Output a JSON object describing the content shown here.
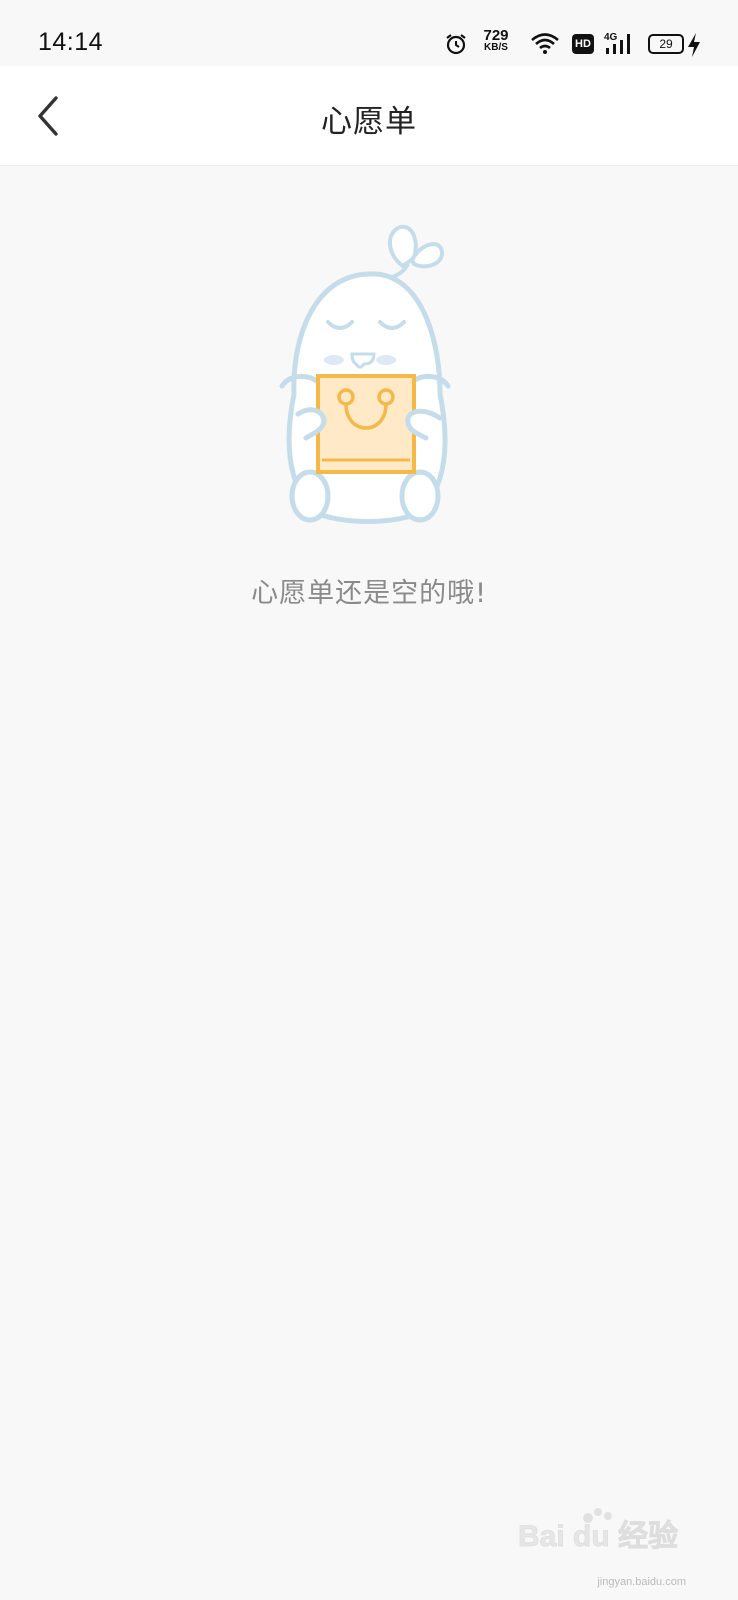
{
  "status_bar": {
    "time": "14:14",
    "net_speed_value": "729",
    "net_speed_unit": "KB/S",
    "hd_label": "HD",
    "network_type": "4G",
    "battery_level": "29",
    "icons": [
      "alarm-icon",
      "wifi-icon",
      "signal-icon",
      "battery-icon",
      "charging-icon"
    ]
  },
  "nav": {
    "title": "心愿单",
    "back_icon": "chevron-left-icon"
  },
  "empty_state": {
    "message": "心愿单还是空的哦!",
    "illustration": "mascot-holding-shopping-bag"
  },
  "watermark": {
    "brand": "Bai du 经验",
    "url": "jingyan.baidu.com"
  },
  "colors": {
    "background": "#f8f8f8",
    "nav_background": "#ffffff",
    "mascot_outline": "#c5dcea",
    "bag_fill": "#ffe9c7",
    "bag_outline": "#f5b94a",
    "message_text": "#8a8a8a"
  }
}
